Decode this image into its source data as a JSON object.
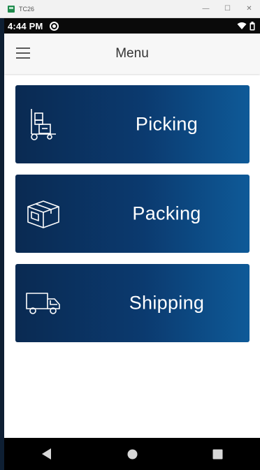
{
  "window": {
    "title": "TC26",
    "controls": {
      "minimize": "—",
      "maximize": "☐",
      "close": "✕"
    }
  },
  "status_bar": {
    "time": "4:44 PM",
    "icons": [
      "sync-icon",
      "wifi-icon",
      "battery-icon"
    ]
  },
  "app_bar": {
    "title": "Menu",
    "menu_icon": "hamburger-menu-icon"
  },
  "menu": {
    "items": [
      {
        "label": "Picking",
        "icon": "hand-truck-icon"
      },
      {
        "label": "Packing",
        "icon": "box-icon"
      },
      {
        "label": "Shipping",
        "icon": "delivery-truck-icon"
      }
    ]
  },
  "nav_bar": {
    "buttons": [
      "back-icon",
      "home-icon",
      "recents-icon"
    ]
  },
  "colors": {
    "tile_gradient_start": "#0a2a52",
    "tile_gradient_end": "#0e5a98",
    "app_bar": "#f7f7f7",
    "status_bar": "#0a0a0a"
  }
}
